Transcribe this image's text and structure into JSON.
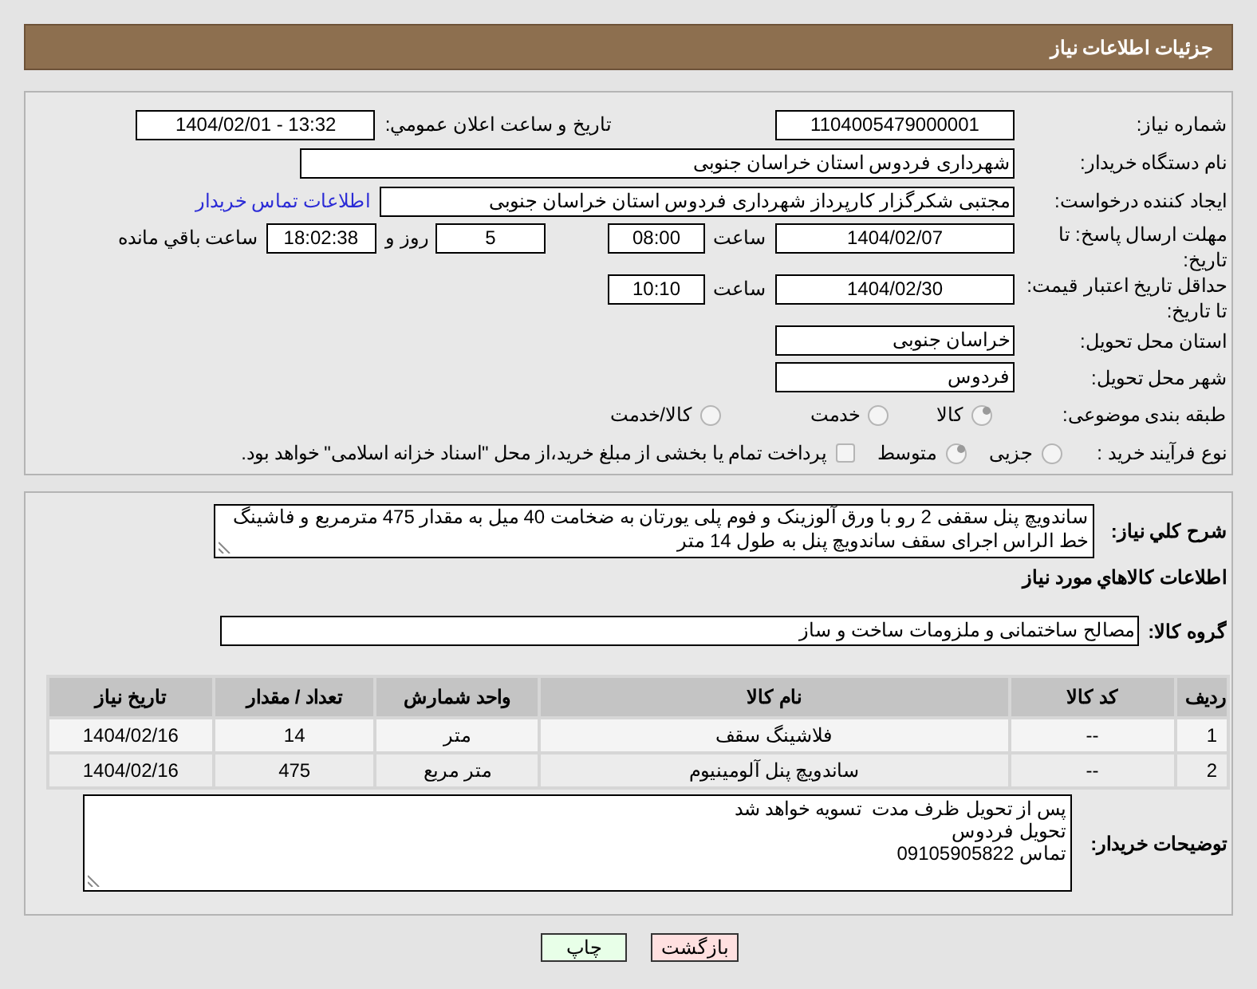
{
  "header": {
    "title": "جزئیات اطلاعات نیاز"
  },
  "need_number": {
    "label": "شماره نیاز:",
    "value": "1104005479000001"
  },
  "announce": {
    "label": "تاریخ و ساعت اعلان عمومي:",
    "value": "1404/02/01 - 13:32"
  },
  "buyer_org": {
    "label": "نام دستگاه خریدار:",
    "value": "شهرداری فردوس استان خراسان جنوبی"
  },
  "requester": {
    "label": "ایجاد کننده درخواست:",
    "value": "مجتبی شکرگزار کارپرداز شهرداری فردوس استان خراسان جنوبی",
    "link": "اطلاعات تماس خریدار"
  },
  "reply_deadline": {
    "label": "مهلت ارسال پاسخ: تا تاریخ:",
    "date": "1404/02/07",
    "time_label": "ساعت",
    "time": "08:00",
    "days": "5",
    "days_label": "روز و",
    "remaining": "18:02:38",
    "remaining_label": "ساعت باقي مانده"
  },
  "price_validity": {
    "label": "حداقل تاریخ اعتبار قیمت: تا تاریخ:",
    "date": "1404/02/30",
    "time_label": "ساعت",
    "time": "10:10"
  },
  "delivery_province": {
    "label": "استان محل تحویل:",
    "value": "خراسان جنوبی"
  },
  "delivery_city": {
    "label": "شهر محل تحویل:",
    "value": "فردوس"
  },
  "category": {
    "label": "طبقه بندی موضوعی:",
    "options": [
      {
        "label": "کالا",
        "selected": true
      },
      {
        "label": "خدمت",
        "selected": false
      },
      {
        "label": "کالا/خدمت",
        "selected": false
      }
    ]
  },
  "process": {
    "label": "نوع فرآیند خرید :",
    "options": [
      {
        "label": "جزیی",
        "selected": false
      },
      {
        "label": "متوسط",
        "selected": true
      }
    ],
    "payment": {
      "checked": false,
      "text": "پرداخت تمام یا بخشی از مبلغ خرید،از محل \"اسناد خزانه اسلامی\" خواهد بود."
    }
  },
  "description": {
    "label": "شرح کلي نیاز:",
    "value": "ساندویچ پنل سقفی 2 رو با ورق آلوزینک و فوم پلی یورتان به ضخامت 40 میل به مقدار 475 مترمربع و فاشینگ خط الراس اجرای سقف  ساندویچ پنل به طول 14 متر"
  },
  "goods_heading": "اطلاعات کالاهاي مورد نیاز",
  "goods_group": {
    "label": "گروه کالا:",
    "value": "مصالح ساختمانی و ملزومات ساخت و ساز"
  },
  "table": {
    "columns": [
      "ردیف",
      "کد کالا",
      "نام کالا",
      "واحد شمارش",
      "تعداد / مقدار",
      "تاریخ نیاز"
    ],
    "rows": [
      [
        "1",
        "--",
        "فلاشینگ سقف",
        "متر",
        "14",
        "1404/02/16"
      ],
      [
        "2",
        "--",
        "ساندویچ پنل آلومینیوم",
        "متر مربع",
        "475",
        "1404/02/16"
      ]
    ]
  },
  "buyer_notes": {
    "label": "توضیحات خریدار:",
    "value": "پس از تحویل ظرف مدت  تسویه خواهد شد\nتحویل فردوس\nتماس 09105905822"
  },
  "buttons": [
    {
      "label": "بازگشت",
      "kind": "back"
    },
    {
      "label": "چاپ",
      "kind": "print"
    }
  ]
}
